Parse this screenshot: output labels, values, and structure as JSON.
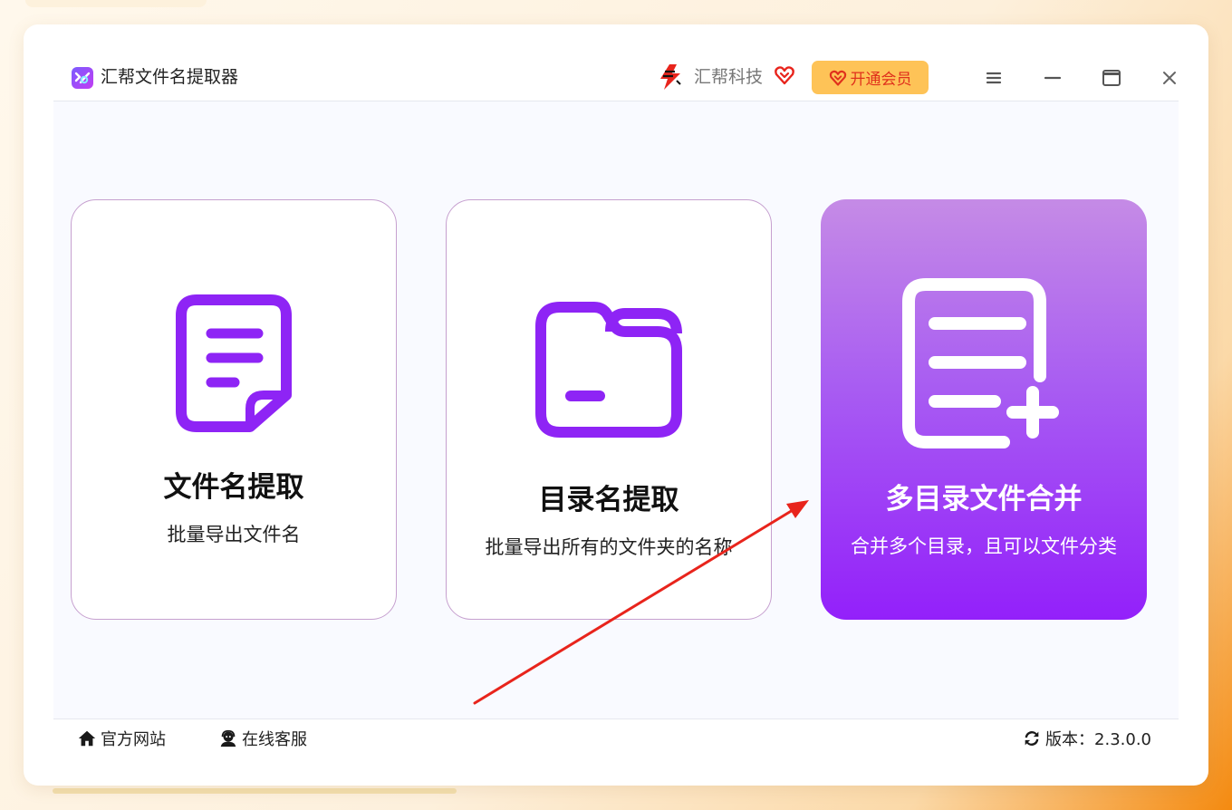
{
  "app": {
    "title": "汇帮文件名提取器"
  },
  "header": {
    "brand_name": "汇帮科技",
    "vip_label": "开通会员"
  },
  "cards": [
    {
      "title": "文件名提取",
      "desc": "批量导出文件名"
    },
    {
      "title": "目录名提取",
      "desc": "批量导出所有的文件夹的名称"
    },
    {
      "title": "多目录文件合并",
      "desc": "合并多个目录，且可以文件分类"
    }
  ],
  "footer": {
    "website": "官方网站",
    "support": "在线客服",
    "version": "版本：2.3.0.0"
  },
  "colors": {
    "accent": "#9320fa",
    "vip": "#fec357",
    "vip_text": "#e0311c",
    "arrow": "#e8241c"
  }
}
